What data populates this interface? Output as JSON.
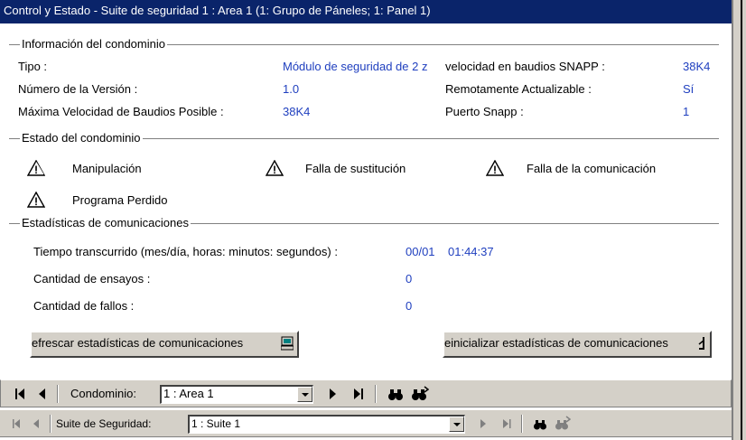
{
  "window": {
    "title": "Control y Estado - Suite de seguridad 1 : Area 1    (1: Grupo de Páneles; 1: Panel 1)"
  },
  "info": {
    "heading": "Información del condominio",
    "tipo_label": "Tipo :",
    "tipo_value": "Módulo de seguridad de 2 z",
    "velocidad_label": "velocidad en baudios SNAPP :",
    "velocidad_value": "38K4",
    "version_label": "Número de la Versión :",
    "version_value": "1.0",
    "remote_label": "Remotamente Actualizable :",
    "remote_value": "Sí",
    "maxbaud_label": "Máxima Velocidad de Baudios Posible :",
    "maxbaud_value": "38K4",
    "port_label": "Puerto Snapp :",
    "port_value": "1"
  },
  "estado": {
    "heading": "Estado del condominio",
    "items": [
      "Manipulación",
      "Falla de sustitución",
      "Falla de la comunicación",
      "Programa Perdido"
    ],
    "icon": "warning-triangle-icon"
  },
  "stats": {
    "heading": "Estadísticas de comunicaciones",
    "elapsed_label": "Tiempo transcurrido (mes/día, horas: minutos: segundos) :",
    "elapsed_date": "00/01",
    "elapsed_time": "01:44:37",
    "tries_label": "Cantidad de ensayos :",
    "tries_value": "0",
    "fails_label": "Cantidad de fallos :",
    "fails_value": "0"
  },
  "buttons": {
    "refresh": "efrescar estadísticas de comunicaciones",
    "reset": "einicializar estadísticas de comunicaciones"
  },
  "nav_main": {
    "label": "Condominio:",
    "value": "1 : Area 1"
  },
  "nav_sub": {
    "label": "Suite de Seguridad:",
    "value": "1 : Suite 1"
  },
  "colors": {
    "title_bg": "#0a246a",
    "value_text": "#1f3fbf",
    "face": "#d4d0c8"
  }
}
